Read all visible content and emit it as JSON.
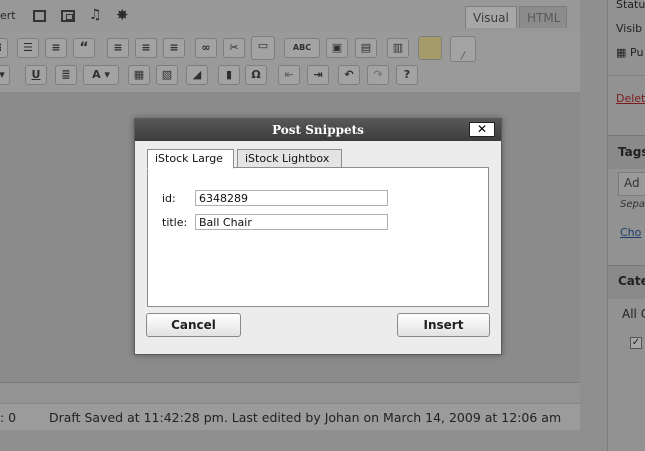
{
  "editor": {
    "insert_label_partial": "ert",
    "tabs": {
      "visual": "Visual",
      "html": "HTML"
    },
    "toolbar_row1": [
      "bold-list",
      "bullet-list",
      "numbered-list",
      "blockquote",
      "align-left",
      "align-center",
      "align-right",
      "link",
      "unlink",
      "more",
      "spellcheck",
      "fullscreen",
      "kitchen-sink",
      "paste-word",
      "note",
      "clear"
    ],
    "toolbar_row2": [
      "underline",
      "justify",
      "text-color",
      "paste-text",
      "paste-word",
      "remove-format",
      "media",
      "special-char",
      "outdent",
      "indent",
      "undo",
      "redo",
      "help"
    ],
    "icons": {
      "underline": "U",
      "text_color": "A",
      "omega": "Ω",
      "abc": "ABC",
      "help": "?"
    }
  },
  "status_bar": {
    "word_count_partial": ": 0",
    "draft_text": "Draft Saved at 11:42:28 pm. Last edited by Johan on March 14, 2009 at 12:06 am"
  },
  "right_column": {
    "status_partial": "Statu",
    "visibility_partial": "Visib",
    "publish_partial": "Pu",
    "delete_partial": "Delet",
    "tags_title_partial": "Tags",
    "tags_input_partial": "Ad",
    "separate_partial": "Sepa",
    "choose_partial": "Cho",
    "categories_title_partial": "Cate",
    "all_categories_partial": "All C"
  },
  "modal": {
    "title": "Post Snippets",
    "close_label": "✕",
    "tabs": [
      "iStock Large",
      "iStock Lightbox"
    ],
    "fields": [
      {
        "label": "id:",
        "value": "6348289"
      },
      {
        "label": "title:",
        "value": "Ball Chair"
      }
    ],
    "cancel_label": "Cancel",
    "insert_label": "Insert"
  },
  "colors": {
    "overlay_bg": "#8f8f8f",
    "modal_titlebar": "#4a4a4a",
    "modal_bg": "#ececec",
    "delete_link": "#8b1d1d",
    "choose_link": "#1d3d6b"
  }
}
